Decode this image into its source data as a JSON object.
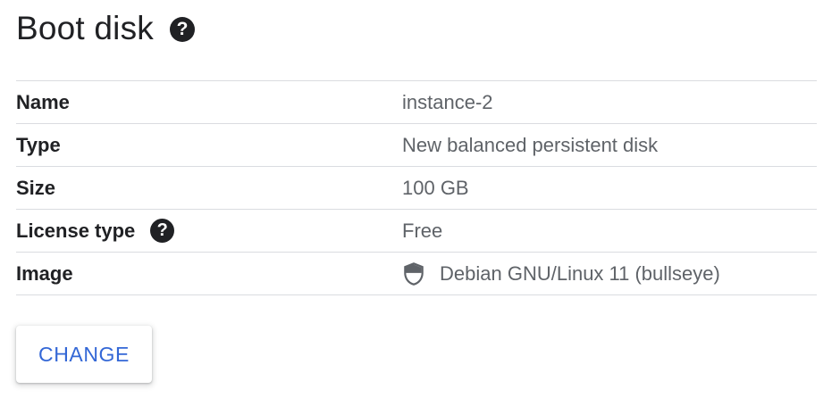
{
  "header": {
    "title": "Boot disk",
    "help_icon": "help-circle-icon"
  },
  "rows": [
    {
      "label": "Name",
      "value": "instance-2"
    },
    {
      "label": "Type",
      "value": "New balanced persistent disk"
    },
    {
      "label": "Size",
      "value": "100 GB"
    },
    {
      "label": "License type",
      "value": "Free",
      "label_icon": "help-circle-icon"
    },
    {
      "label": "Image",
      "value": "Debian GNU/Linux 11 (bullseye)",
      "value_icon": "shield-icon"
    }
  ],
  "actions": {
    "change_label": "CHANGE"
  },
  "colors": {
    "text_primary": "#202124",
    "text_secondary": "#5f6368",
    "divider": "#dadce0",
    "accent": "#3367d6"
  }
}
